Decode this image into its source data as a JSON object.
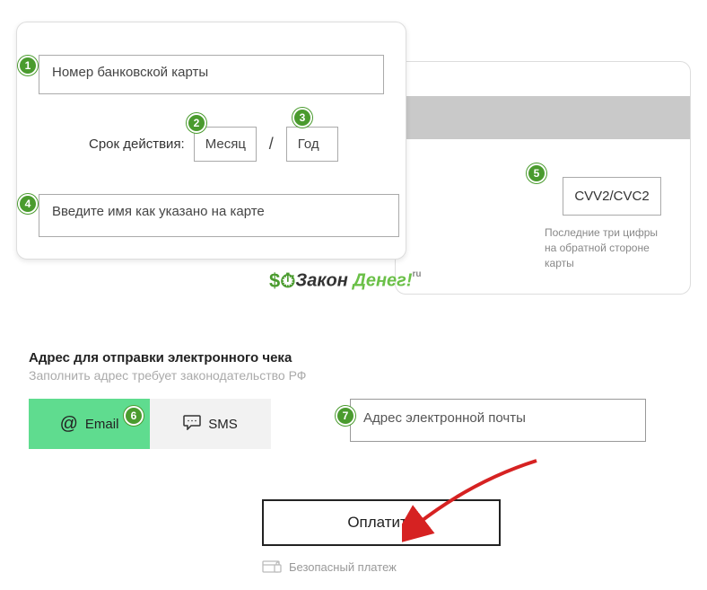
{
  "badges": {
    "b1": "1",
    "b2": "2",
    "b3": "3",
    "b4": "4",
    "b5": "5",
    "b6": "6",
    "b7": "7"
  },
  "card": {
    "number_placeholder": "Номер банковской карты",
    "expiry_label": "Срок действия:",
    "month_placeholder": "Месяц",
    "sep": "/",
    "year_placeholder": "Год",
    "name_placeholder": "Введите имя как указано на карте",
    "cvv_placeholder": "CVV2/CVC2",
    "cvv_hint": "Последние три цифры на обратной стороне карты"
  },
  "logo": {
    "icon": "$⏱",
    "text1": "Закон ",
    "text2": "Денег!",
    "ru": "ru"
  },
  "receipt": {
    "title": "Адрес для отправки электронного чека",
    "subtitle": "Заполнить адрес требует законодательство РФ",
    "email_tab": "Email",
    "sms_tab": "SMS",
    "email_input_placeholder": "Адрес электронной почты"
  },
  "pay_button": "Оплатить",
  "secure": "Безопасный платеж"
}
